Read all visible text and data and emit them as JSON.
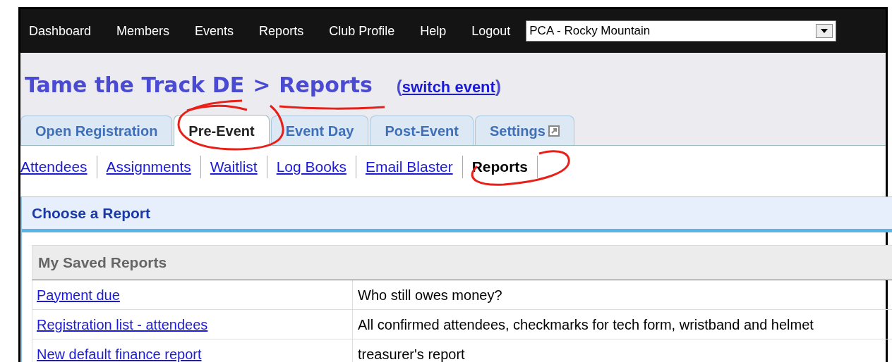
{
  "nav": [
    "Dashboard",
    "Members",
    "Events",
    "Reports",
    "Club Profile",
    "Help",
    "Logout"
  ],
  "club_select": {
    "value": "PCA - Rocky Mountain"
  },
  "breadcrumb": {
    "event": "Tame the Track DE",
    "separator": ">",
    "page": "Reports",
    "switch_open": "(",
    "switch_link": "switch event",
    "switch_close": ")"
  },
  "tabs": [
    {
      "label": "Open Registration",
      "selected": false,
      "external": false
    },
    {
      "label": "Pre-Event",
      "selected": true,
      "external": false
    },
    {
      "label": "Event Day",
      "selected": false,
      "external": false
    },
    {
      "label": "Post-Event",
      "selected": false,
      "external": false
    },
    {
      "label": "Settings",
      "selected": false,
      "external": true
    }
  ],
  "subnav": [
    {
      "label": "Attendees",
      "selected": false
    },
    {
      "label": "Assignments",
      "selected": false
    },
    {
      "label": "Waitlist",
      "selected": false
    },
    {
      "label": "Log Books",
      "selected": false
    },
    {
      "label": "Email Blaster",
      "selected": false
    },
    {
      "label": "Reports",
      "selected": true
    }
  ],
  "panel": {
    "title": "Choose a Report",
    "section": "My Saved Reports",
    "rows": [
      {
        "name": "Payment due",
        "description": "Who still owes money?"
      },
      {
        "name": "Registration list - attendees",
        "description": "All confirmed attendees, checkmarks for tech form, wristband and helmet"
      },
      {
        "name": "New default finance report",
        "description": "treasurer's report"
      }
    ]
  }
}
